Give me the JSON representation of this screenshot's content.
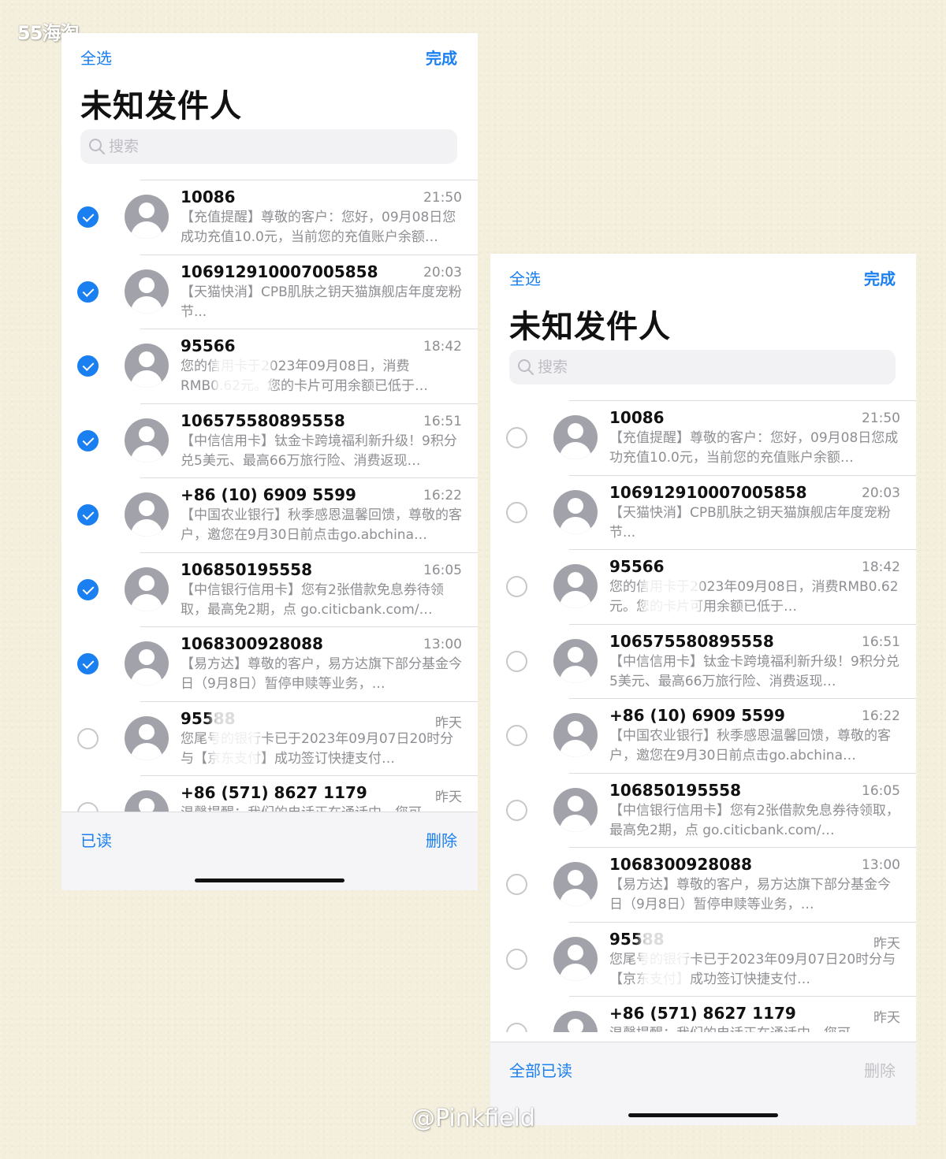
{
  "watermarks": {
    "top": "55海淘",
    "bottom": "@Pinkfield"
  },
  "colors": {
    "accent": "#1a7ff0",
    "secondary_text": "#8e8e93",
    "avatar": "#a2a2aa"
  },
  "screens": [
    {
      "select_all": "全选",
      "done": "完成",
      "title": "未知发件人",
      "search_placeholder": "搜索",
      "footer_left": "已读",
      "footer_right": "删除",
      "footer_right_enabled": true,
      "messages": [
        {
          "sender": "10086",
          "time": "21:50",
          "preview": "【充值提醒】尊敬的客户：您好，09月08日您成功充值10.0元，当前您的充值账户余额…",
          "selected": true
        },
        {
          "sender": "106912910007005858",
          "time": "20:03",
          "preview": "【天猫快消】CPB肌肤之钥天猫旗舰店年度宠粉节...",
          "selected": true
        },
        {
          "sender": "95566",
          "time": "18:42",
          "preview": "您的信用卡于2023年09月08日，消费RMB0.62元。您的卡片可用余额已低于…",
          "selected": true
        },
        {
          "sender": "106575580895558",
          "time": "16:51",
          "preview": "【中信信用卡】钛金卡跨境福利新升级！9积分兑5美元、最高66万旅行险、消费返现…",
          "selected": true
        },
        {
          "sender": "+86 (10) 6909 5599",
          "time": "16:22",
          "preview": "【中国农业银行】秋季感恩温馨回馈，尊敬的客户，邀您在9月30日前点击go.abchina…",
          "selected": true
        },
        {
          "sender": "106850195558",
          "time": "16:05",
          "preview": "【中信银行信用卡】您有2张借款免息券待领取，最高免2期，点 go.citicbank.com/…",
          "selected": true
        },
        {
          "sender": "1068300928088",
          "time": "13:00",
          "preview": "【易方达】尊敬的客户，易方达旗下部分基金今日（9月8日）暂停申赎等业务，…",
          "selected": true
        },
        {
          "sender": "95588",
          "time": "昨天",
          "preview": "您尾号的银行卡已于2023年09月07日20时分与【京东支付】成功签订快捷支付…",
          "selected": false
        },
        {
          "sender": "+86 (571) 8627 1179",
          "time": "昨天",
          "preview": "温馨提醒：我们的电话正在通话中，您可…",
          "selected": false
        }
      ]
    },
    {
      "select_all": "全选",
      "done": "完成",
      "title": "未知发件人",
      "search_placeholder": "搜索",
      "footer_left": "全部已读",
      "footer_right": "删除",
      "footer_right_enabled": false,
      "messages": [
        {
          "sender": "10086",
          "time": "21:50",
          "preview": "【充值提醒】尊敬的客户：您好，09月08日您成功充值10.0元，当前您的充值账户余额…",
          "selected": false
        },
        {
          "sender": "106912910007005858",
          "time": "20:03",
          "preview": "【天猫快消】CPB肌肤之钥天猫旗舰店年度宠粉节...",
          "selected": false
        },
        {
          "sender": "95566",
          "time": "18:42",
          "preview": "您的信用卡于2023年09月08日，消费RMB0.62元。您的卡片可用余额已低于…",
          "selected": false
        },
        {
          "sender": "106575580895558",
          "time": "16:51",
          "preview": "【中信信用卡】钛金卡跨境福利新升级！9积分兑5美元、最高66万旅行险、消费返现…",
          "selected": false
        },
        {
          "sender": "+86 (10) 6909 5599",
          "time": "16:22",
          "preview": "【中国农业银行】秋季感恩温馨回馈，尊敬的客户，邀您在9月30日前点击go.abchina…",
          "selected": false
        },
        {
          "sender": "106850195558",
          "time": "16:05",
          "preview": "【中信银行信用卡】您有2张借款免息券待领取，最高免2期，点 go.citicbank.com/…",
          "selected": false
        },
        {
          "sender": "1068300928088",
          "time": "13:00",
          "preview": "【易方达】尊敬的客户，易方达旗下部分基金今日（9月8日）暂停申赎等业务，…",
          "selected": false
        },
        {
          "sender": "95588",
          "time": "昨天",
          "preview": "您尾号的银行卡已于2023年09月07日20时分与【京东支付】成功签订快捷支付…",
          "selected": false
        },
        {
          "sender": "+86 (571) 8627 1179",
          "time": "昨天",
          "preview": "温馨提醒：我们的电话正在通话中，您可…",
          "selected": false
        }
      ]
    }
  ]
}
